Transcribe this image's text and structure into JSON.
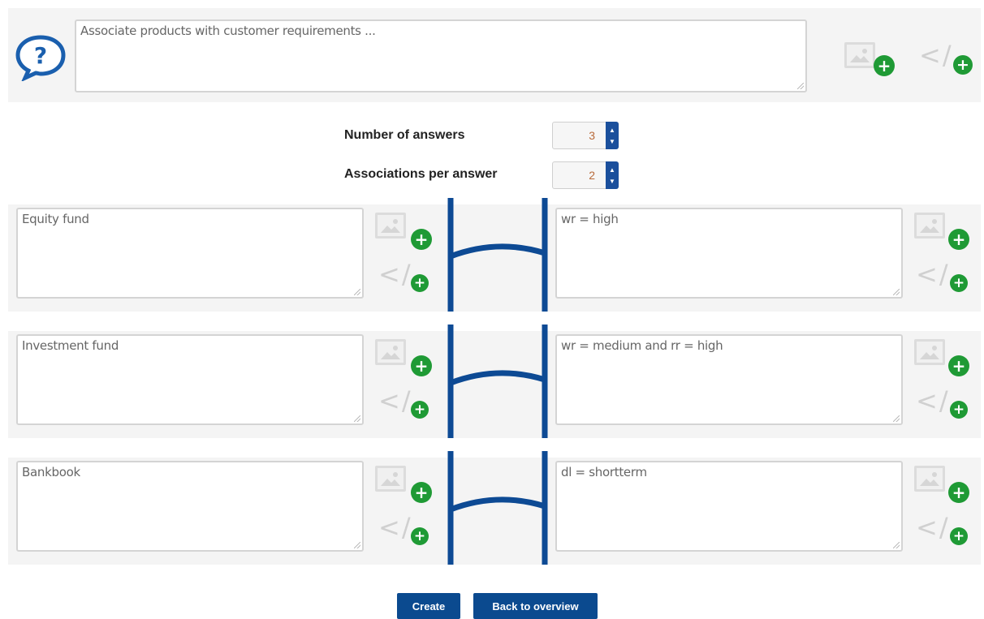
{
  "question": {
    "text": "Associate products with customer requirements ..."
  },
  "settings": {
    "answers_label": "Number of answers",
    "answers_value": "3",
    "assoc_label": "Associations per answer",
    "assoc_value": "2"
  },
  "pairs": [
    {
      "left": "Equity fund",
      "right": "wr = high"
    },
    {
      "left": "Investment fund",
      "right": "wr = medium and rr = high"
    },
    {
      "left": "Bankbook",
      "right": "dl = shortterm"
    }
  ],
  "buttons": {
    "create": "Create",
    "back": "Back to overview"
  },
  "icons": {
    "help": "question-bubble-icon",
    "add_image": "image-plus-icon",
    "add_code": "code-plus-icon"
  },
  "colors": {
    "accent_blue": "#0b4a8f",
    "add_green": "#1f9a35"
  }
}
